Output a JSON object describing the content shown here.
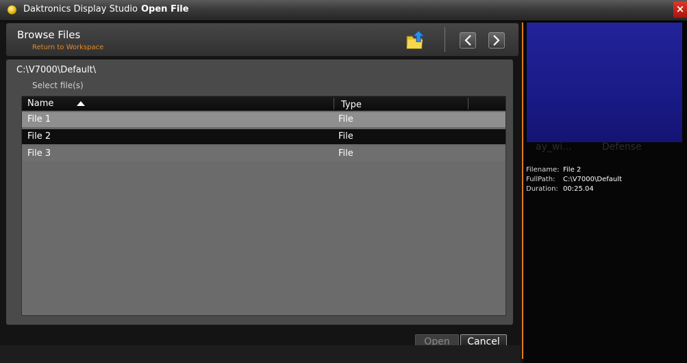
{
  "window": {
    "app_name": "Daktronics Display Studio",
    "dialog_name": "Open File",
    "close_glyph": "×"
  },
  "header": {
    "title": "Browse Files",
    "return_link": "Return to Workspace",
    "icons": [
      "folder-up-icon",
      "chevron-left-icon",
      "chevron-right-icon"
    ]
  },
  "browser": {
    "path": "C:\\V7000\\Default\\",
    "hint": "Select file(s)",
    "columns": {
      "name": "Name",
      "type": "Type"
    },
    "sort": "ascending",
    "rows": [
      {
        "name": "File 1",
        "type": "File",
        "selected": false
      },
      {
        "name": "File 2",
        "type": "File",
        "selected": true
      },
      {
        "name": "File 3",
        "type": "File",
        "selected": false
      }
    ]
  },
  "buttons": {
    "open": "Open",
    "cancel": "Cancel"
  },
  "preview": {
    "background_text_1": "ay_wi...",
    "background_text_2": "Defense",
    "info": [
      {
        "label": "Filename:",
        "value": "File 2"
      },
      {
        "label": "FullPath:",
        "value": "C:\\V7000\\Default"
      },
      {
        "label": "Duration:",
        "value": "00:25.04"
      }
    ]
  },
  "colors": {
    "accent_orange": "#e37b1a",
    "preview_blue": "#1a1a88",
    "selected_row": "#0e0e0e"
  }
}
